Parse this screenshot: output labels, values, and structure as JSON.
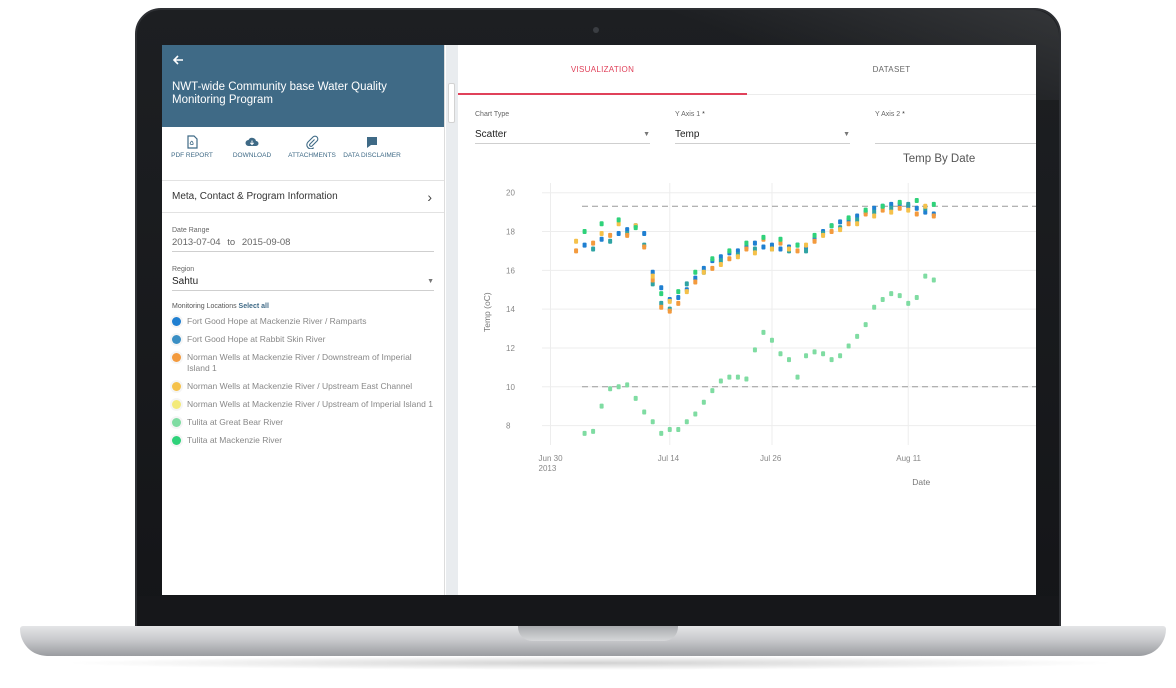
{
  "app": {
    "back_icon": "arrow-left-icon",
    "title": "NWT-wide Community base Water Quality Monitoring Program"
  },
  "toolbar": [
    {
      "label": "PDF REPORT",
      "icon": "pdf-icon"
    },
    {
      "label": "DOWNLOAD",
      "icon": "cloud-download-icon"
    },
    {
      "label": "ATTACHMENTS",
      "icon": "paperclip-icon"
    },
    {
      "label": "DATA DISCLAIMER",
      "icon": "disclaimer-icon"
    }
  ],
  "meta_section": {
    "label": "Meta, Contact & Program Information"
  },
  "date_range": {
    "label": "Date Range",
    "from": "2013-07-04",
    "to_word": "to",
    "to": "2015-09-08"
  },
  "region": {
    "label": "Region",
    "value": "Sahtu"
  },
  "monitoring": {
    "label": "Monitoring Locations",
    "select_all": "Select all",
    "locations": [
      {
        "name": "Fort Good Hope at Mackenzie River / Ramparts",
        "color": "#1f7fd1"
      },
      {
        "name": "Fort Good Hope at Rabbit Skin River",
        "color": "#3a8fc4"
      },
      {
        "name": "Norman Wells at Mackenzie River / Downstream of Imperial Island 1",
        "color": "#f39a3d"
      },
      {
        "name": "Norman Wells at Mackenzie River / Upstream East Channel",
        "color": "#f5c14a"
      },
      {
        "name": "Norman Wells at Mackenzie River / Upstream of Imperial Island 1",
        "color": "#f3ea7a"
      },
      {
        "name": "Tulita at Great Bear River",
        "color": "#7fdca2"
      },
      {
        "name": "Tulita at Mackenzie River",
        "color": "#2fd27a"
      }
    ]
  },
  "tabs": [
    {
      "label": "VISUALIZATION",
      "active": true
    },
    {
      "label": "DATASET",
      "active": false
    }
  ],
  "controls": {
    "chart_type": {
      "label": "Chart Type",
      "value": "Scatter"
    },
    "y_axis_1": {
      "label": "Y Axis 1",
      "value": "Temp"
    },
    "y_axis_2": {
      "label": "Y Axis 2",
      "value": ""
    },
    "required_mark": "*"
  },
  "chart_data": {
    "type": "scatter",
    "title": "Temp By Date",
    "xlabel": "Date",
    "ylabel": "Temp (oC)",
    "ylim": [
      7,
      20.5
    ],
    "xlim": [
      -1,
      57
    ],
    "yticks": [
      8,
      10,
      12,
      14,
      16,
      18,
      20
    ],
    "xticks": [
      {
        "value": 0,
        "label": "Jun 30",
        "sublabel": "2013"
      },
      {
        "value": 14,
        "label": "Jul 14",
        "sublabel": ""
      },
      {
        "value": 26,
        "label": "Jul 26",
        "sublabel": ""
      },
      {
        "value": 42,
        "label": "Aug 11",
        "sublabel": ""
      }
    ],
    "x_unit": "days from Jun 30, 2013",
    "grid": true,
    "reference_lines": [
      19.3,
      10.0
    ],
    "series": [
      {
        "color": "#1f7fd1",
        "points": [
          [
            4,
            17.3
          ],
          [
            6,
            17.6
          ],
          [
            8,
            17.9
          ],
          [
            9,
            18.1
          ],
          [
            10,
            18.3
          ],
          [
            11,
            17.9
          ],
          [
            12,
            15.9
          ],
          [
            13,
            15.1
          ],
          [
            14,
            14.5
          ],
          [
            15,
            14.6
          ],
          [
            16,
            15.0
          ],
          [
            17,
            15.6
          ],
          [
            18,
            16.1
          ],
          [
            19,
            16.5
          ],
          [
            20,
            16.7
          ],
          [
            21,
            16.9
          ],
          [
            22,
            17.0
          ],
          [
            23,
            17.2
          ],
          [
            24,
            17.4
          ],
          [
            25,
            17.2
          ],
          [
            26,
            17.3
          ],
          [
            27,
            17.1
          ],
          [
            28,
            17.2
          ],
          [
            29,
            17.3
          ],
          [
            30,
            17.2
          ],
          [
            31,
            17.6
          ],
          [
            32,
            18.0
          ],
          [
            33,
            18.3
          ],
          [
            34,
            18.5
          ],
          [
            35,
            18.6
          ],
          [
            36,
            18.8
          ],
          [
            37,
            19.0
          ],
          [
            38,
            19.2
          ],
          [
            39,
            19.3
          ],
          [
            40,
            19.4
          ],
          [
            41,
            19.4
          ],
          [
            42,
            19.3
          ],
          [
            43,
            19.2
          ],
          [
            44,
            19.0
          ],
          [
            45,
            18.9
          ]
        ]
      },
      {
        "color": "#2fa3a3",
        "points": [
          [
            5,
            17.1
          ],
          [
            7,
            17.5
          ],
          [
            9,
            17.9
          ],
          [
            11,
            17.3
          ],
          [
            12,
            15.3
          ],
          [
            13,
            14.3
          ],
          [
            14,
            14.0
          ],
          [
            16,
            15.3
          ],
          [
            18,
            15.9
          ],
          [
            20,
            16.5
          ],
          [
            22,
            16.8
          ],
          [
            24,
            17.1
          ],
          [
            26,
            17.1
          ],
          [
            28,
            17.0
          ],
          [
            30,
            17.0
          ],
          [
            32,
            17.9
          ],
          [
            34,
            18.2
          ],
          [
            36,
            18.6
          ],
          [
            38,
            19.0
          ],
          [
            40,
            19.2
          ],
          [
            42,
            19.4
          ],
          [
            44,
            19.2
          ]
        ]
      },
      {
        "color": "#f39a3d",
        "points": [
          [
            3,
            17.0
          ],
          [
            5,
            17.4
          ],
          [
            7,
            17.8
          ],
          [
            9,
            17.8
          ],
          [
            11,
            17.2
          ],
          [
            12,
            15.5
          ],
          [
            13,
            14.1
          ],
          [
            14,
            13.9
          ],
          [
            15,
            14.3
          ],
          [
            17,
            15.4
          ],
          [
            19,
            16.1
          ],
          [
            21,
            16.6
          ],
          [
            23,
            17.1
          ],
          [
            25,
            17.6
          ],
          [
            27,
            17.4
          ],
          [
            29,
            17.0
          ],
          [
            31,
            17.5
          ],
          [
            33,
            18.0
          ],
          [
            35,
            18.4
          ],
          [
            37,
            18.9
          ],
          [
            39,
            19.1
          ],
          [
            41,
            19.2
          ],
          [
            43,
            18.9
          ],
          [
            45,
            18.8
          ]
        ]
      },
      {
        "color": "#f5c14a",
        "points": [
          [
            3,
            17.5
          ],
          [
            6,
            17.9
          ],
          [
            8,
            18.4
          ],
          [
            10,
            18.3
          ],
          [
            12,
            15.7
          ],
          [
            14,
            14.4
          ],
          [
            16,
            14.9
          ],
          [
            18,
            15.9
          ],
          [
            20,
            16.3
          ],
          [
            22,
            16.7
          ],
          [
            24,
            16.9
          ],
          [
            26,
            17.1
          ],
          [
            28,
            17.1
          ],
          [
            30,
            17.3
          ],
          [
            32,
            17.8
          ],
          [
            34,
            18.1
          ],
          [
            36,
            18.4
          ],
          [
            38,
            18.8
          ],
          [
            40,
            19.0
          ],
          [
            42,
            19.1
          ],
          [
            44,
            19.3
          ]
        ]
      },
      {
        "color": "#2fd27a",
        "points": [
          [
            4,
            18.0
          ],
          [
            6,
            18.4
          ],
          [
            8,
            18.6
          ],
          [
            10,
            18.2
          ],
          [
            13,
            14.8
          ],
          [
            15,
            14.9
          ],
          [
            17,
            15.9
          ],
          [
            19,
            16.6
          ],
          [
            21,
            17.0
          ],
          [
            23,
            17.4
          ],
          [
            25,
            17.7
          ],
          [
            27,
            17.6
          ],
          [
            29,
            17.3
          ],
          [
            31,
            17.8
          ],
          [
            33,
            18.3
          ],
          [
            35,
            18.7
          ],
          [
            37,
            19.1
          ],
          [
            39,
            19.3
          ],
          [
            41,
            19.5
          ],
          [
            43,
            19.6
          ],
          [
            45,
            19.4
          ]
        ]
      },
      {
        "color": "#7fdca2",
        "points": [
          [
            4,
            7.6
          ],
          [
            5,
            7.7
          ],
          [
            6,
            9.0
          ],
          [
            7,
            9.9
          ],
          [
            8,
            10.0
          ],
          [
            9,
            10.1
          ],
          [
            10,
            9.4
          ],
          [
            11,
            8.7
          ],
          [
            12,
            8.2
          ],
          [
            13,
            7.6
          ],
          [
            14,
            7.8
          ],
          [
            15,
            7.8
          ],
          [
            16,
            8.2
          ],
          [
            17,
            8.6
          ],
          [
            18,
            9.2
          ],
          [
            19,
            9.8
          ],
          [
            20,
            10.3
          ],
          [
            21,
            10.5
          ],
          [
            22,
            10.5
          ],
          [
            23,
            10.4
          ],
          [
            24,
            11.9
          ],
          [
            25,
            12.8
          ],
          [
            26,
            12.4
          ],
          [
            27,
            11.7
          ],
          [
            28,
            11.4
          ],
          [
            29,
            10.5
          ],
          [
            30,
            11.6
          ],
          [
            31,
            11.8
          ],
          [
            32,
            11.7
          ],
          [
            33,
            11.4
          ],
          [
            34,
            11.6
          ],
          [
            35,
            12.1
          ],
          [
            36,
            12.6
          ],
          [
            37,
            13.2
          ],
          [
            38,
            14.1
          ],
          [
            39,
            14.5
          ],
          [
            40,
            14.8
          ],
          [
            41,
            14.7
          ],
          [
            42,
            14.3
          ],
          [
            43,
            14.6
          ],
          [
            44,
            15.7
          ],
          [
            45,
            15.5
          ]
        ]
      }
    ]
  }
}
